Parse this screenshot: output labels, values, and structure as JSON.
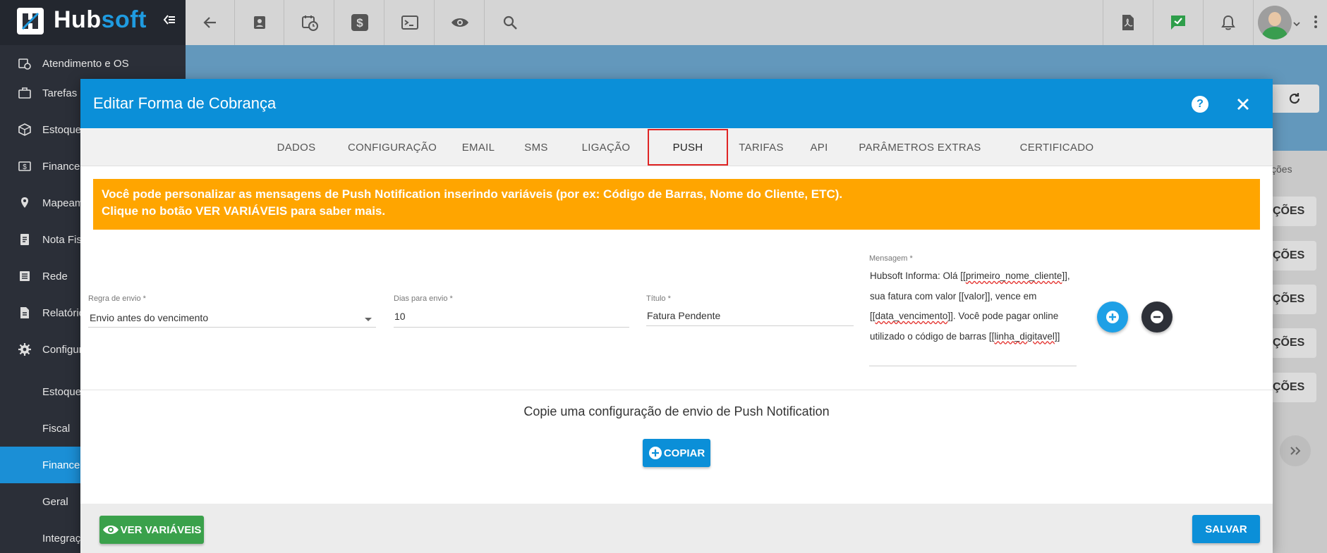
{
  "brand": {
    "name_part1": "Hub",
    "name_part2": "soft"
  },
  "topbar": {
    "icons": [
      "back-arrow-icon",
      "contact-icon",
      "calendar-clock-icon",
      "dollar-icon",
      "terminal-icon",
      "eye-icon",
      "search-icon"
    ],
    "right_icons": [
      "pdf-icon",
      "chat-check-icon",
      "bell-icon"
    ]
  },
  "sidebar": {
    "items": [
      {
        "label": "Atendimento e OS"
      },
      {
        "label": "Tarefas"
      },
      {
        "label": "Estoque"
      },
      {
        "label": "Financeiro"
      },
      {
        "label": "Mapeamento"
      },
      {
        "label": "Nota Fiscal"
      },
      {
        "label": "Rede"
      },
      {
        "label": "Relatórios"
      },
      {
        "label": "Configurações"
      }
    ],
    "subitems": [
      {
        "label": "Estoque"
      },
      {
        "label": "Fiscal"
      },
      {
        "label": "Financeiro"
      },
      {
        "label": "Geral"
      },
      {
        "label": "Integrações"
      }
    ]
  },
  "background": {
    "column_header": "ções",
    "row_buttons": [
      "ÇÕES",
      "ÇÕES",
      "ÇÕES",
      "ÇÕES",
      "ÇÕES"
    ]
  },
  "modal": {
    "title": "Editar Forma de Cobrança",
    "tabs": [
      "DADOS",
      "CONFIGURAÇÃO",
      "EMAIL",
      "SMS",
      "LIGAÇÃO",
      "PUSH",
      "TARIFAS",
      "API",
      "PARÂMETROS EXTRAS",
      "CERTIFICADO"
    ],
    "active_tab": "PUSH",
    "alert": {
      "line1": "Você pode personalizar as mensagens de Push Notification inserindo variáveis (por ex: Código de Barras, Nome do Cliente, ETC).",
      "line2": "Clique no botão VER VARIÁVEIS para saber mais."
    },
    "form": {
      "regra_label": "Regra de envio *",
      "regra_value": "Envio antes do vencimento",
      "dias_label": "Dias para envio *",
      "dias_value": "10",
      "titulo_label": "Título *",
      "titulo_value": "Fatura Pendente",
      "mensagem_label": "Mensagem *",
      "mensagem_parts": {
        "p1": "Hubsoft Informa: Olá [[",
        "v1": "primeiro_nome_cliente",
        "p2": "]], sua fatura com valor [[valor]], vence em [[",
        "v2": "data_vencimento",
        "p3": "]]. Você pode pagar online utilizado o código de barras [[",
        "v3": "linha_digitavel",
        "p4": "]]"
      }
    },
    "copy_text": "Copie uma configuração de envio de Push Notification",
    "copy_button": "COPIAR",
    "ver_variaveis_button": "VER VARIÁVEIS",
    "salvar_button": "SALVAR"
  },
  "colors": {
    "header_blue": "#0b8fd8",
    "alert_orange": "#ffa500",
    "green": "#3aa14b",
    "sidebar_dark": "#2b2f38",
    "active_tab_border": "#e02424"
  }
}
